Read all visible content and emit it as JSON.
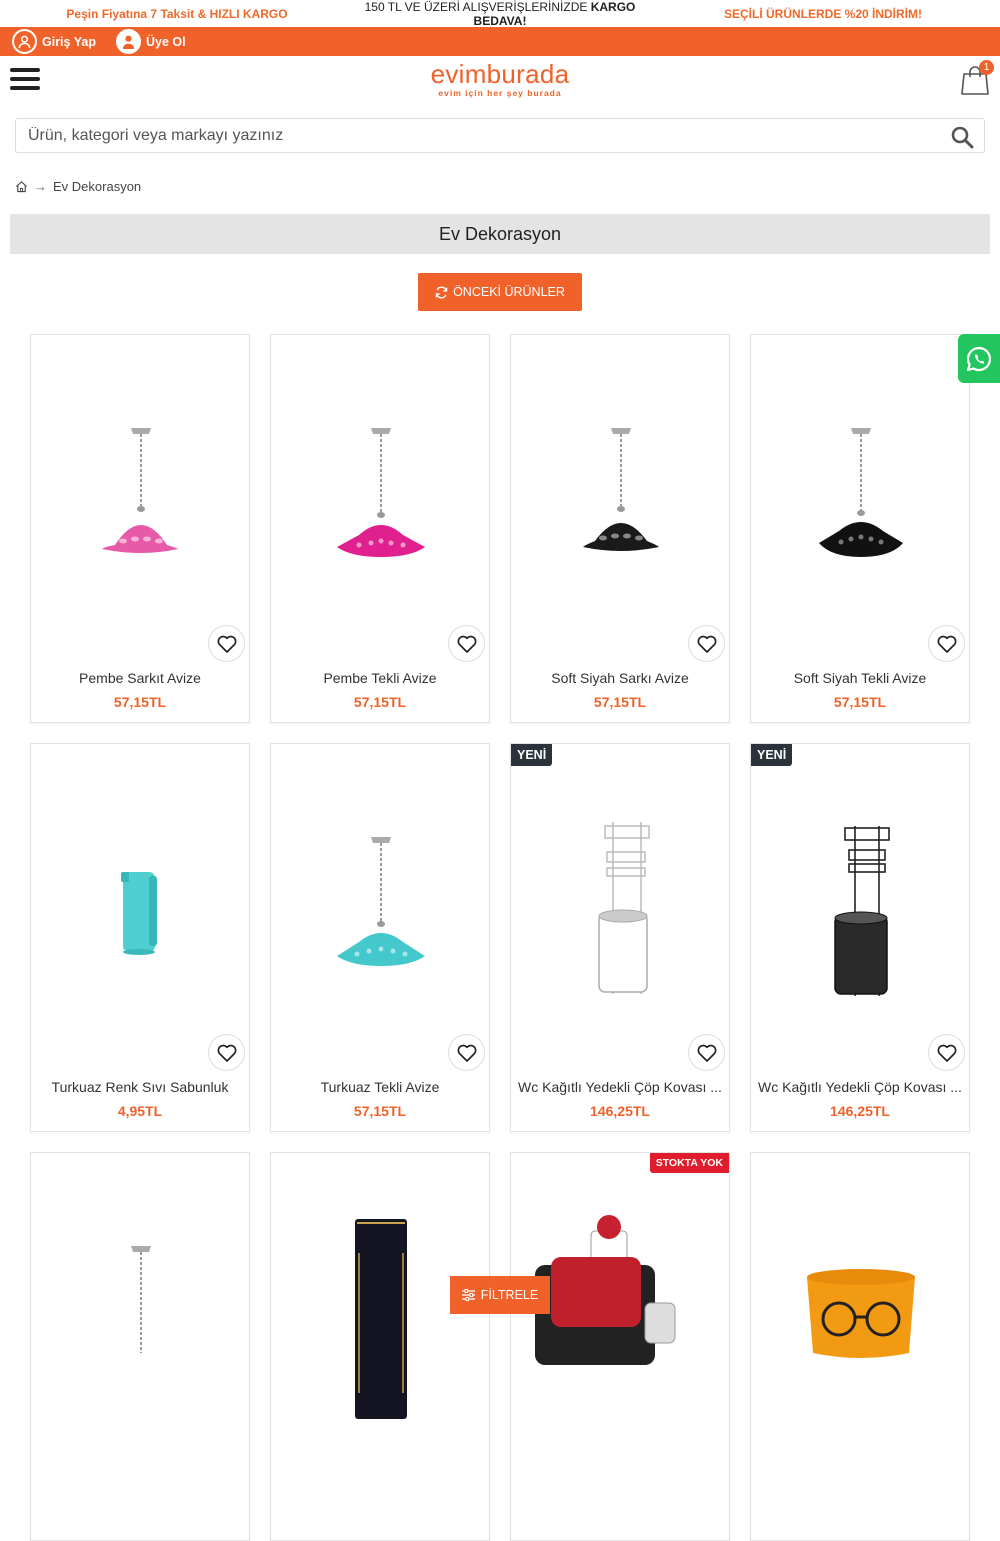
{
  "promo": {
    "left_prefix": "Peşin Fiyatına 7 Taksit & ",
    "left_bold": "HIZLI KARGO",
    "center_prefix": "150 TL VE ÜZERİ ALIŞVERİŞLERİNİZDE ",
    "center_bold": "KARGO BEDAVA!",
    "right": "SEÇİLİ ÜRÜNLERDE %20 İNDİRİM!"
  },
  "user": {
    "login_label": "Giriş Yap",
    "register_label": "Üye Ol"
  },
  "header": {
    "brand": "evimburada",
    "tagline": "evim için her şey burada",
    "cart_count": "1"
  },
  "search": {
    "placeholder": "Ürün, kategori veya markayı yazınız"
  },
  "breadcrumb": {
    "separator": "→",
    "current": "Ev Dekorasyon"
  },
  "category": {
    "title": "Ev Dekorasyon"
  },
  "prev_button": {
    "label": "ÖNCEKİ ÜRÜNLER"
  },
  "filter_button": {
    "label": "FİLTRELE"
  },
  "colors": {
    "accent": "#f0622a",
    "new_badge": "#2a333c",
    "out_badge": "#e01d2c",
    "whatsapp": "#23c55e"
  },
  "products": [
    {
      "name": "Pembe Sarkıt Avize",
      "price": "57,15TL",
      "image": "pink-pendant-lamp-icon"
    },
    {
      "name": "Pembe Tekli Avize",
      "price": "57,15TL",
      "image": "pink-pendant-lamp-icon"
    },
    {
      "name": "Soft Siyah Sarkı Avize",
      "price": "57,15TL",
      "image": "black-pendant-lamp-icon"
    },
    {
      "name": "Soft Siyah Tekli Avize",
      "price": "57,15TL",
      "image": "black-pendant-lamp-icon"
    },
    {
      "name": "Turkuaz Renk Sıvı Sabunluk",
      "price": "4,95TL",
      "image": "turquoise-soap-dispenser-icon"
    },
    {
      "name": "Turkuaz Tekli Avize",
      "price": "57,15TL",
      "image": "turquoise-pendant-lamp-icon"
    },
    {
      "name": "Wc Kağıtlı Yedekli Çöp Kovası ...",
      "price": "146,25TL",
      "badge": "YENİ",
      "image": "white-wc-bin-stand-icon"
    },
    {
      "name": "Wc Kağıtlı Yedekli Çöp Kovası ...",
      "price": "146,25TL",
      "badge": "YENİ",
      "image": "black-wc-bin-stand-icon"
    },
    {
      "name": "",
      "price": "",
      "image": "pendant-lamp-icon"
    },
    {
      "name": "",
      "price": "",
      "image": "black-vase-icon"
    },
    {
      "name": "",
      "price": "",
      "badge_out": "STOKTA YOK",
      "image": "juicer-icon"
    },
    {
      "name": "",
      "price": "",
      "image": "orange-basket-icon"
    }
  ]
}
